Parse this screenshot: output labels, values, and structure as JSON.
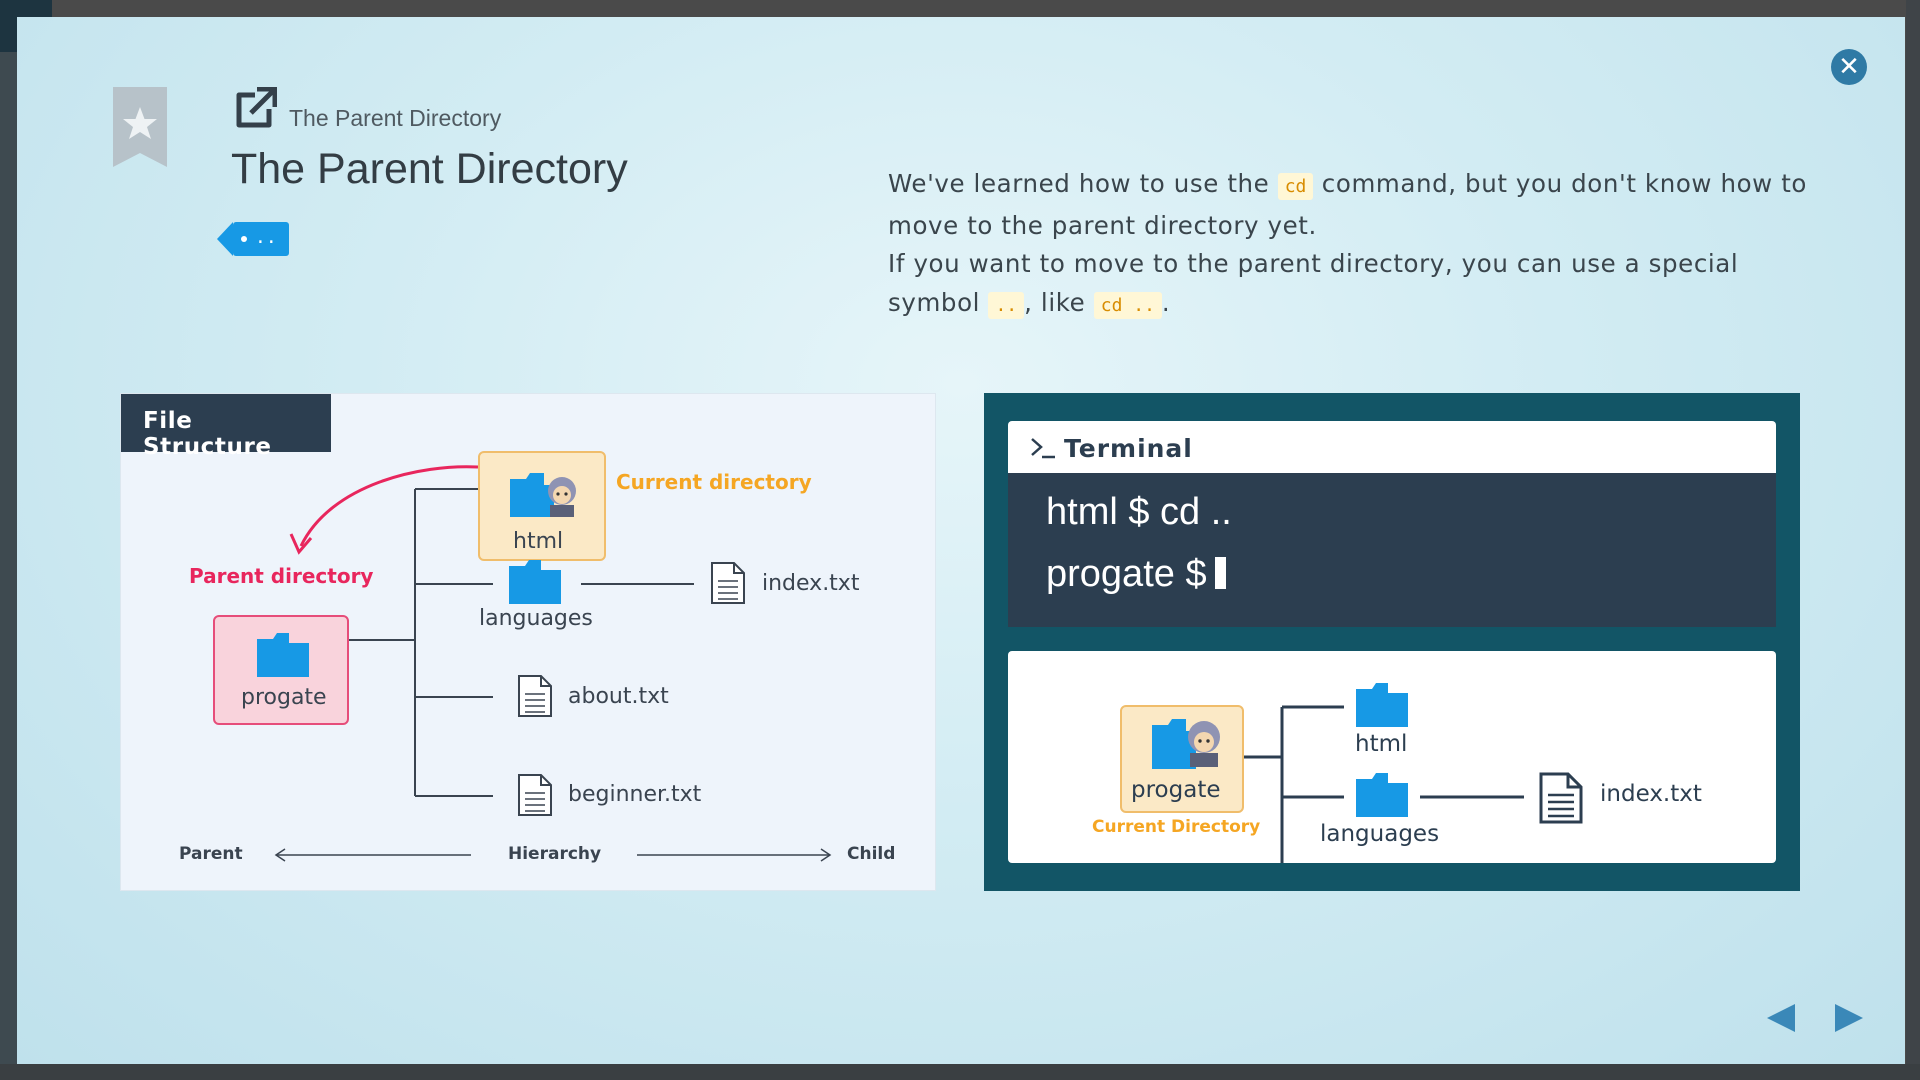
{
  "modal": {
    "breadcrumb": "The Parent Directory",
    "title": "The Parent Directory",
    "tag_label": "..",
    "close_icon": "close-icon",
    "bookmark_icon": "bookmark-star-icon",
    "external_link_icon": "external-link-icon"
  },
  "description": {
    "line1_pre": "We've learned how to use the ",
    "line1_code": "cd",
    "line1_post": " command, but you don't know how to move to the parent directory yet.",
    "line2_pre": "If you want to move to the parent directory, you can use a special symbol ",
    "line2_code1": "..",
    "line2_mid": ", like ",
    "line2_code2": "cd ..",
    "line2_post": "."
  },
  "file_structure": {
    "header": "File Structure",
    "current_label": "Current directory",
    "parent_label": "Parent directory",
    "html_folder": "html",
    "progate_folder": "progate",
    "languages_folder": "languages",
    "index_file": "index.txt",
    "about_file": "about.txt",
    "beginner_file": "beginner.txt",
    "axis_parent": "Parent",
    "axis_hierarchy": "Hierarchy",
    "axis_child": "Child"
  },
  "terminal": {
    "title": "Terminal",
    "line1": "html $ cd ..",
    "line2": "progate $",
    "diagram": {
      "progate_folder": "progate",
      "current_label": "Current Directory",
      "html_folder": "html",
      "languages_folder": "languages",
      "index_file": "index.txt"
    }
  },
  "navigation": {
    "prev_icon": "triangle-left-icon",
    "next_icon": "triangle-right-icon"
  },
  "colors": {
    "accent_blue": "#1799e5",
    "orange": "#f5a623",
    "pink": "#e8265d",
    "dark": "#2c3e50",
    "teal": "#125566"
  }
}
